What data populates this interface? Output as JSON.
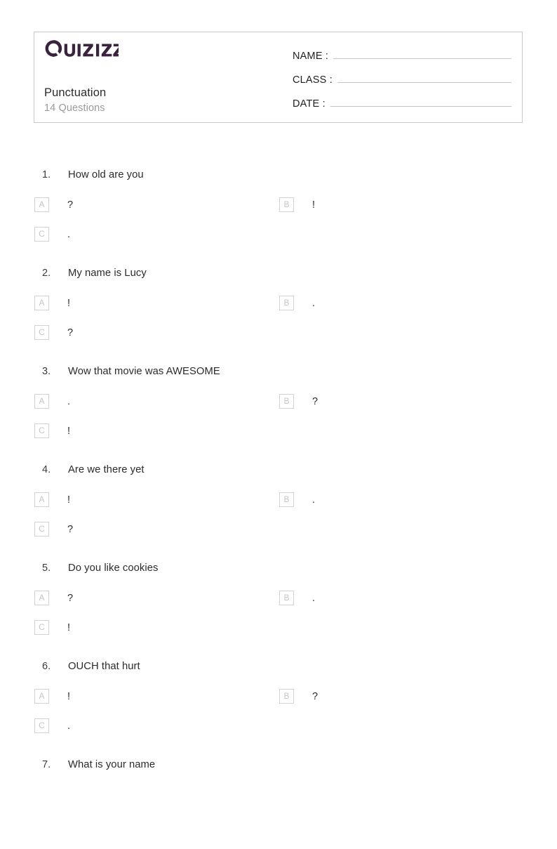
{
  "brand": {
    "logo_name": "quizizz-logo",
    "logo_text": "Quizizz",
    "logo_color": "#3b2340"
  },
  "header": {
    "quiz_title": "Punctuation",
    "quiz_subtitle": "14 Questions",
    "fields": [
      {
        "label": "NAME :",
        "value": ""
      },
      {
        "label": "CLASS :",
        "value": ""
      },
      {
        "label": "DATE  :",
        "value": ""
      }
    ]
  },
  "questions": [
    {
      "number": "1.",
      "text": "How old are you",
      "options": [
        {
          "key": "A",
          "text": "?"
        },
        {
          "key": "B",
          "text": "!"
        },
        {
          "key": "C",
          "text": "."
        }
      ]
    },
    {
      "number": "2.",
      "text": "My name is Lucy",
      "options": [
        {
          "key": "A",
          "text": "!"
        },
        {
          "key": "B",
          "text": "."
        },
        {
          "key": "C",
          "text": "?"
        }
      ]
    },
    {
      "number": "3.",
      "text": "Wow that movie was AWESOME",
      "options": [
        {
          "key": "A",
          "text": "."
        },
        {
          "key": "B",
          "text": "?"
        },
        {
          "key": "C",
          "text": "!"
        }
      ]
    },
    {
      "number": "4.",
      "text": "Are we there yet",
      "options": [
        {
          "key": "A",
          "text": "!"
        },
        {
          "key": "B",
          "text": "."
        },
        {
          "key": "C",
          "text": "?"
        }
      ]
    },
    {
      "number": "5.",
      "text": "Do you like cookies",
      "options": [
        {
          "key": "A",
          "text": "?"
        },
        {
          "key": "B",
          "text": "."
        },
        {
          "key": "C",
          "text": "!"
        }
      ]
    },
    {
      "number": "6.",
      "text": "OUCH that hurt",
      "options": [
        {
          "key": "A",
          "text": "!"
        },
        {
          "key": "B",
          "text": "?"
        },
        {
          "key": "C",
          "text": "."
        }
      ]
    },
    {
      "number": "7.",
      "text": "What is your name",
      "options": []
    }
  ]
}
